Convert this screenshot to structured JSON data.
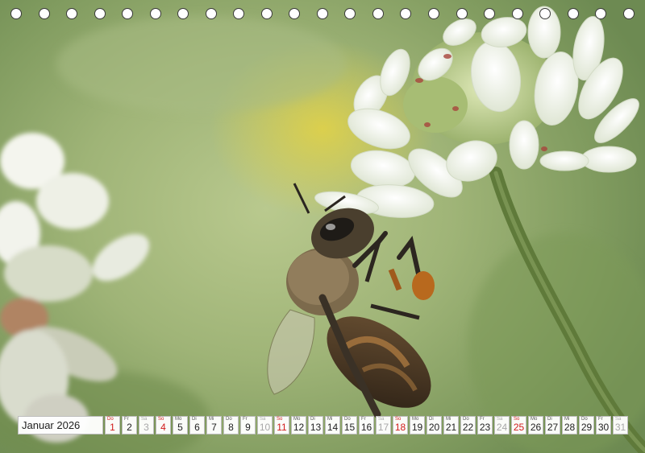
{
  "calendar": {
    "month": "Januar 2026",
    "days": [
      {
        "wd": "Do",
        "d": "1",
        "type": "red"
      },
      {
        "wd": "Fr",
        "d": "2",
        "type": "normal"
      },
      {
        "wd": "Sa",
        "d": "3",
        "type": "sat"
      },
      {
        "wd": "So",
        "d": "4",
        "type": "red"
      },
      {
        "wd": "Mo",
        "d": "5",
        "type": "normal"
      },
      {
        "wd": "Di",
        "d": "6",
        "type": "normal"
      },
      {
        "wd": "Mi",
        "d": "7",
        "type": "normal"
      },
      {
        "wd": "Do",
        "d": "8",
        "type": "normal"
      },
      {
        "wd": "Fr",
        "d": "9",
        "type": "normal"
      },
      {
        "wd": "Sa",
        "d": "10",
        "type": "sat"
      },
      {
        "wd": "So",
        "d": "11",
        "type": "red"
      },
      {
        "wd": "Mo",
        "d": "12",
        "type": "normal"
      },
      {
        "wd": "Di",
        "d": "13",
        "type": "normal"
      },
      {
        "wd": "Mi",
        "d": "14",
        "type": "normal"
      },
      {
        "wd": "Do",
        "d": "15",
        "type": "normal"
      },
      {
        "wd": "Fr",
        "d": "16",
        "type": "normal"
      },
      {
        "wd": "Sa",
        "d": "17",
        "type": "sat"
      },
      {
        "wd": "So",
        "d": "18",
        "type": "red"
      },
      {
        "wd": "Mo",
        "d": "19",
        "type": "normal"
      },
      {
        "wd": "Di",
        "d": "20",
        "type": "normal"
      },
      {
        "wd": "Mi",
        "d": "21",
        "type": "normal"
      },
      {
        "wd": "Do",
        "d": "22",
        "type": "normal"
      },
      {
        "wd": "Fr",
        "d": "23",
        "type": "normal"
      },
      {
        "wd": "Sa",
        "d": "24",
        "type": "sat"
      },
      {
        "wd": "So",
        "d": "25",
        "type": "red"
      },
      {
        "wd": "Mo",
        "d": "26",
        "type": "normal"
      },
      {
        "wd": "Di",
        "d": "27",
        "type": "normal"
      },
      {
        "wd": "Mi",
        "d": "28",
        "type": "normal"
      },
      {
        "wd": "Do",
        "d": "29",
        "type": "normal"
      },
      {
        "wd": "Fr",
        "d": "30",
        "type": "normal"
      },
      {
        "wd": "Sa",
        "d": "31",
        "type": "sat"
      }
    ]
  },
  "binding_holes": 23,
  "colors": {
    "sunday_red": "#d11a1a",
    "saturday_grey": "#a8a8a8",
    "background_green": "#9fb477",
    "flower_white": "#ffffff"
  },
  "photo_subject": "bee-on-clover-blossom"
}
